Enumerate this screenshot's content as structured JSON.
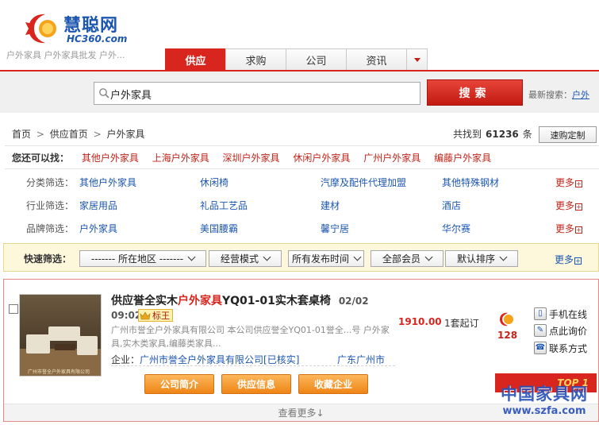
{
  "logo": {
    "name": "慧聪网",
    "domain": "HC360.com"
  },
  "header": {
    "hot_keywords": "户外家具 户外家具批发 户外...",
    "tabs": [
      {
        "label": "供应",
        "active": true
      },
      {
        "label": "求购",
        "active": false
      },
      {
        "label": "公司",
        "active": false
      },
      {
        "label": "资讯",
        "active": false
      }
    ]
  },
  "search": {
    "query": "户外家具",
    "button": "搜索",
    "recent_label": "最新搜索：",
    "recent_value": "户外"
  },
  "breadcrumb": {
    "items": [
      "首页",
      "供应首页",
      "户外家具"
    ],
    "separator": ">"
  },
  "results": {
    "prefix": "共找到",
    "count": "61236",
    "suffix": "条",
    "quick_order": "速购定制"
  },
  "also_find": {
    "label": "您还可以找：",
    "links": [
      "其他户外家具",
      "上海户外家具",
      "深圳户外家具",
      "休闲户外家具",
      "广州户外家具",
      "编藤户外家具"
    ]
  },
  "filters": {
    "more_label": "更多",
    "rows": [
      {
        "label": "分类筛选：",
        "items": [
          "其他户外家具",
          "休闲椅",
          "汽摩及配件代理加盟",
          "其他特殊钢材"
        ]
      },
      {
        "label": "行业筛选：",
        "items": [
          "家居用品",
          "礼品工艺品",
          "建材",
          "酒店"
        ]
      },
      {
        "label": "品牌筛选：",
        "items": [
          "户外家具",
          "美国腰霸",
          "馨宁居",
          "华尔赛"
        ]
      }
    ]
  },
  "quick_filter": {
    "label": "快速筛选：",
    "selects": [
      "------- 所在地区 -------",
      "经营模式",
      "所有发布时间",
      "全部会员",
      "默认排序"
    ],
    "more_label": "更多"
  },
  "listing": {
    "title_prefix": "供应誉全实木",
    "title_keyword": "户外家具",
    "title_suffix": "YQ01-01实木套桌椅",
    "date": "02/02",
    "time": "09:02",
    "badge": "标王",
    "description": "广州市誉全户外家具有限公司 本公司供应誉全YQ01-01誉全...号 户外家具,实木类家具,编藤类家具...",
    "company_label": "企业：",
    "company": "广州市誉全户外家具有限公司[已核实]",
    "location": "广东广州市",
    "price": "1910.00",
    "moq": "1套起订",
    "score": "128",
    "contacts": [
      "手机在线",
      "点此询价",
      "联系方式"
    ],
    "actions": [
      "公司简介",
      "供应信息",
      "收藏企业"
    ],
    "more": "查看更多↓",
    "ribbon": "TOP 1",
    "thumb_caption": "广州市誉全户外家具有限公司"
  },
  "watermark": {
    "line1": "中国家具网",
    "line2": "www.szfa.com"
  },
  "colors": {
    "brand_red": "#d8261e",
    "link_blue": "#1c56b0",
    "action_orange": "#ee8516"
  }
}
